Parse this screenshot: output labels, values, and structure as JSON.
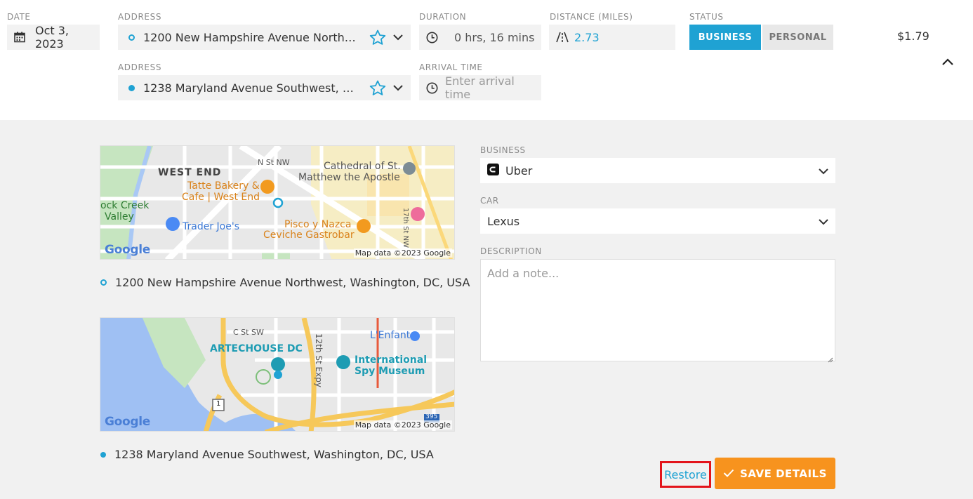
{
  "trip": {
    "date_label": "DATE",
    "date_value": "Oct 3, 2023",
    "address_label_1": "ADDRESS",
    "address_1": "1200 New Hampshire Avenue Northwest, ...",
    "address_label_2": "ADDRESS",
    "address_2": "1238 Maryland Avenue Southwest, Washin...",
    "duration_label": "DURATION",
    "duration_value": "0 hrs, 16 mins",
    "distance_label": "DISTANCE (MILES)",
    "distance_value": "2.73",
    "arrival_label": "ARRIVAL TIME",
    "arrival_placeholder": "Enter arrival time",
    "status_label": "STATUS",
    "status_options": [
      "BUSINESS",
      "PERSONAL"
    ],
    "status_selected": "BUSINESS",
    "price": "$1.79"
  },
  "maps": {
    "credit": "Map data ©2023 Google",
    "google": "Google",
    "map1": {
      "labels": [
        "N St NW",
        "WEST END",
        "Cathedral of St.",
        "Matthew the Apostle",
        "Tatte Bakery &",
        "Cafe | West End",
        "ock Creek",
        "Valley",
        "Trader Joe's",
        "Pisco y Nazca",
        "Ceviche Gastrobar",
        "17th St NW"
      ]
    },
    "map2": {
      "labels": [
        "C St SW",
        "L'Enfant",
        "ARTECHOUSE DC",
        "12th St Expy",
        "International",
        "Spy Museum",
        "1",
        "395"
      ]
    },
    "start_address": "1200 New Hampshire Avenue Northwest, Washington, DC, USA",
    "end_address": "1238 Maryland Avenue Southwest, Washington, DC, USA"
  },
  "form": {
    "business_label": "BUSINESS",
    "business_value": "Uber",
    "car_label": "CAR",
    "car_value": "Lexus",
    "description_label": "DESCRIPTION",
    "description_placeholder": "Add a note..."
  },
  "actions": {
    "restore": "Restore",
    "save": "SAVE DETAILS"
  },
  "colors": {
    "accent": "#1fa2d3",
    "save": "#f7931e",
    "highlight_border": "#e3141b"
  }
}
